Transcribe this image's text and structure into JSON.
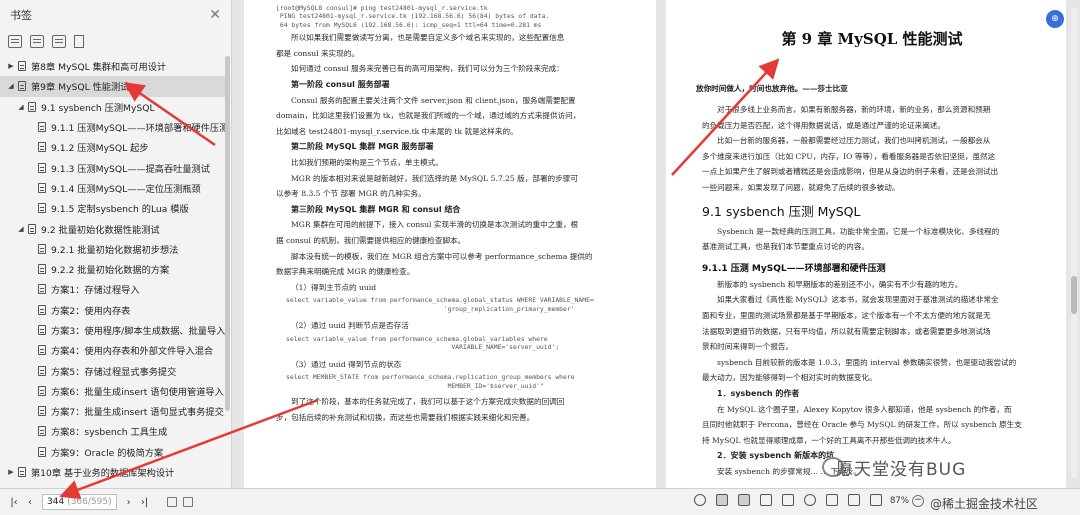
{
  "sidebar": {
    "title": "书签",
    "close": "✕",
    "toc": [
      {
        "label": "第8章  MySQL 集群和高可用设计",
        "level": 0,
        "tri": "▶",
        "selected": false
      },
      {
        "label": "第9章  MySQL 性能测试",
        "level": 0,
        "tri": "◢",
        "selected": true
      },
      {
        "label": "9.1  sysbench 压测MySQL",
        "level": 1,
        "tri": "◢",
        "selected": false
      },
      {
        "label": "9.1.1  压测MySQL——环境部署和硬件压测",
        "level": 2,
        "tri": "",
        "selected": false
      },
      {
        "label": "9.1.2  压测MySQL  起步",
        "level": 2,
        "tri": "",
        "selected": false
      },
      {
        "label": "9.1.3  压测MySQL——提高吞吐量测试",
        "level": 2,
        "tri": "",
        "selected": false
      },
      {
        "label": "9.1.4  压测MySQL——定位压测瓶颈",
        "level": 2,
        "tri": "",
        "selected": false
      },
      {
        "label": "9.1.5  定制sysbench 的Lua 模版",
        "level": 2,
        "tri": "",
        "selected": false
      },
      {
        "label": "9.2  批量初始化数据性能测试",
        "level": 1,
        "tri": "◢",
        "selected": false
      },
      {
        "label": "9.2.1  批量初始化数据初步想法",
        "level": 2,
        "tri": "",
        "selected": false
      },
      {
        "label": "9.2.2  批量初始化数据的方案",
        "level": 2,
        "tri": "",
        "selected": false
      },
      {
        "label": "方案1：存储过程导入",
        "level": 2,
        "tri": "",
        "selected": false
      },
      {
        "label": "方案2：使用内存表",
        "level": 2,
        "tri": "",
        "selected": false
      },
      {
        "label": "方案3：使用程序/脚本生成数据、批量导入",
        "level": 2,
        "tri": "",
        "selected": false
      },
      {
        "label": "方案4：使用内存表和外部文件导入混合",
        "level": 2,
        "tri": "",
        "selected": false
      },
      {
        "label": "方案5：存储过程显式事务提交",
        "level": 2,
        "tri": "",
        "selected": false
      },
      {
        "label": "方案6：批量生成insert 语句使用管道导入",
        "level": 2,
        "tri": "",
        "selected": false
      },
      {
        "label": "方案7：批量生成insert 语句显式事务提交",
        "level": 2,
        "tri": "",
        "selected": false
      },
      {
        "label": "方案8：sysbench 工具生成",
        "level": 2,
        "tri": "",
        "selected": false
      },
      {
        "label": "方案9：Oracle 的极简方案",
        "level": 2,
        "tri": "",
        "selected": false
      },
      {
        "label": "第10章  基于业务的数据库架构设计",
        "level": 0,
        "tri": "▶",
        "selected": false
      }
    ]
  },
  "left_page": {
    "code1": "[root@MySQL8 consul]# ping test24801-mysql_r.service.tk\n PING test24801-mysql_r.service.tk (192.168.56.6) 56(84) bytes of data.\n 64 bytes from MySQL6 (192.168.56.6): icmp_seq=1 ttl=64 time=0.281 ms",
    "lines": [
      {
        "t": "所以如果我们需要做读写分离，也是需要自定义多个域名来实现的，这些配置信息",
        "k": "p"
      },
      {
        "t": "都是 consul 来实现的。",
        "k": "pni"
      },
      {
        "t": "如何通过 consul 服务来完善已有的高可用架构，我们可以分为三个阶段来完成：",
        "k": "p"
      },
      {
        "t": "第一阶段    consul 服务部署",
        "k": "h"
      },
      {
        "t": "Consul  服务的配置主要关注两个文件  server.json  和  client.json，服务端需要配置",
        "k": "p"
      },
      {
        "t": "domain，比如这里我们设置为 tk，也就是我们所域的一个域，通过域的方式来提供访问，",
        "k": "pni"
      },
      {
        "t": "比如域名 test24801-mysql_r.service.tk 中末尾的 tk 就是这样来的。",
        "k": "pni"
      },
      {
        "t": "第二阶段    MySQL 集群 MGR 服务部署",
        "k": "h"
      },
      {
        "t": "比如我们预期的架构是三个节点，单主模式。",
        "k": "p"
      },
      {
        "t": "MGR 的版本相对来说是越新越好，我们选择的是 MySQL 5.7.25 版，部署的步骤可",
        "k": "p"
      },
      {
        "t": "以参考 8.3.5 个节  部署 MGR 的几种实务。",
        "k": "pni"
      },
      {
        "t": "第三阶段    MySQL 集群 MGR 和 consul 结合",
        "k": "h"
      },
      {
        "t": "MGR 集群在可用的前提下，接入 consul 实现半滑的切换是本次测试的重中之重，根",
        "k": "p"
      },
      {
        "t": "据 consul 的机制，我们需要提供相应的健康检查脚本。",
        "k": "pni"
      },
      {
        "t": "脚本没有统一的模板，我们在 MGR 组合方案中可以参考 performance_schema 提供的",
        "k": "p"
      },
      {
        "t": "数据字典来明确完成 MGR 的健康检查。",
        "k": "pni"
      },
      {
        "t": "（1）得到主节点的 uuid",
        "k": "p"
      }
    ],
    "code2": "select variable_value from performance_schema.global_status WHERE VARIABLE_NAME=\n                                         'group_replication_primary_member'",
    "step2": "（2）通过 uuid 判断节点是否存活",
    "code3": "select variable_value from performance_schema.global_variables where\n                                           VARIABLE_NAME='server_uuid';",
    "step3": "（3）通过 uuid 得到节点的状态",
    "code4": "select MEMBER_STATE from performance_schema.replication_group_members where\n                                          MEMBER_ID='$server_uuid'\"",
    "tail": [
      "到了这个阶段，基本的任务就完成了，我们可以基于这个方案完成灾数据的回调回",
      "步，包括后续的补充测试和切换，而这些也需要我们根据实践来细化和完善。"
    ]
  },
  "right_page": {
    "chapter": "第 9 章    MySQL 性能测试",
    "motto": "放你时间做人，时间也放弃他。——莎士比亚",
    "intro": [
      {
        "t": "对于很多线上业务而言，如果有新服务器，新的环境，新的业务，那么资源和预期",
        "k": "p"
      },
      {
        "t": "的负载压力是否匹配，这个得用数据说话，或是通过严谨的论证来阐述。",
        "k": "pni"
      },
      {
        "t": "比如一台新的服务器，一般都需要经过压力测试，我们也叫拷机测试，一般都会从",
        "k": "p"
      },
      {
        "t": "多个维度来进行加压（比如 CPU，内存，IO 等等），看看服务器是否依旧坚挺，虽然这",
        "k": "pni"
      },
      {
        "t": "一点上如果产生了解到或者糟糕还是会造成影响，但是从身边的例子来看，还是会测试出",
        "k": "pni"
      },
      {
        "t": "一些问题来，如果发现了问题，就避免了后续的很多被动。",
        "k": "pni"
      }
    ],
    "sec": "9.1    sysbench 压测 MySQL",
    "sec_lines": [
      {
        "t": "Sysbench  是一款经典的压测工具，功能非常全面，它是一个标准模块化、多线程的",
        "k": "p"
      },
      {
        "t": "基准测试工具，也是我们本节要重点讨论的内容。",
        "k": "pni"
      }
    ],
    "sub": "9.1.1    压测 MySQL——环境部署和硬件压测",
    "sub_lines": [
      {
        "t": "新版本的 sysbench 和早期版本的差别还不小，确实有不少有趣的地方。",
        "k": "p"
      },
      {
        "t": "如果大家看过《高性能 MySQL》这本书，就会发现里面对于基准测试的描述非常全",
        "k": "p"
      },
      {
        "t": "面和专业，里面的测试场景都是基于早期版本，这个版本有一个不太方便的地方就是无",
        "k": "pni"
      },
      {
        "t": "法据取到更细节的数据，只有平均值，所以就有需要定制脚本，或者需要更多地测试场",
        "k": "pni"
      },
      {
        "t": "景和时间来得到一个报告。",
        "k": "pni"
      },
      {
        "t": "sysbench 目前较新的版本是 1.0.3，里面的 interval 参数确实很赞，也是驱动我尝试的",
        "k": "p"
      },
      {
        "t": "最大动力，因为能够得到一个相对实时的数据变化。",
        "k": "pni"
      }
    ],
    "h_author": "1．sysbench 的作者",
    "author_lines": [
      {
        "t": "在 MySQL 这个圈子里，Alexey Kopytov  很多人都知道，他是 sysbench 的作者，而",
        "k": "p"
      },
      {
        "t": "且同时他就职于 Percona，曾经在 Oracle 参与 MySQL 的研发工作，所以 sysbench 原生支",
        "k": "pni"
      },
      {
        "t": "持 MySQL 也就显得顺理成章，一个好的工具离不开那些低调的技术牛人。",
        "k": "pni"
      }
    ],
    "h_install": "2．安装 sysbench 新版本的坑",
    "install_line": "安装 sysbench 的步骤常规…  …  下两步。"
  },
  "statusbar": {
    "first": "|‹",
    "prev": "‹",
    "page_current": "344",
    "page_total": "(366/595)",
    "next": "›",
    "last": "›|",
    "zoom": "87%",
    "zoom_minus": "−"
  },
  "float_button": "⊕",
  "watermark_main": "愿天堂没有BUG",
  "watermark_bottom": "@稀土掘金技术社区",
  "colors": {
    "arrow": "#e53935",
    "accent": "#3a6fd8"
  }
}
